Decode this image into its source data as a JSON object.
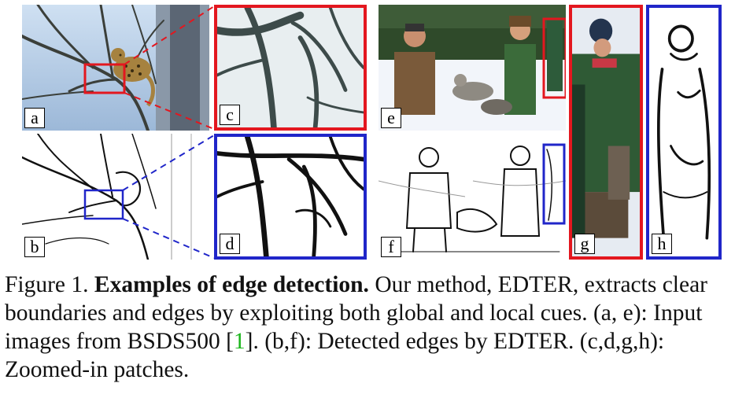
{
  "panels": {
    "a": {
      "label": "a"
    },
    "b": {
      "label": "b"
    },
    "c": {
      "label": "c"
    },
    "d": {
      "label": "d"
    },
    "e": {
      "label": "e"
    },
    "f": {
      "label": "f"
    },
    "g": {
      "label": "g"
    },
    "h": {
      "label": "h"
    }
  },
  "caption": {
    "figure_number": "Figure 1.",
    "bold_title": "Examples of edge detection.",
    "text_1": "Our method, EDTER, extracts clear boundaries and edges by exploiting both global and local cues. (a, e): Input images from BSDS500 [",
    "citation": "1",
    "text_2": "]. (b,f): Detected edges by EDTER. (c,d,g,h): Zoomed-in patches."
  },
  "colors": {
    "zoom_red": "#e3171f",
    "zoom_blue": "#2026c9",
    "citation_green": "#1ab51a"
  }
}
